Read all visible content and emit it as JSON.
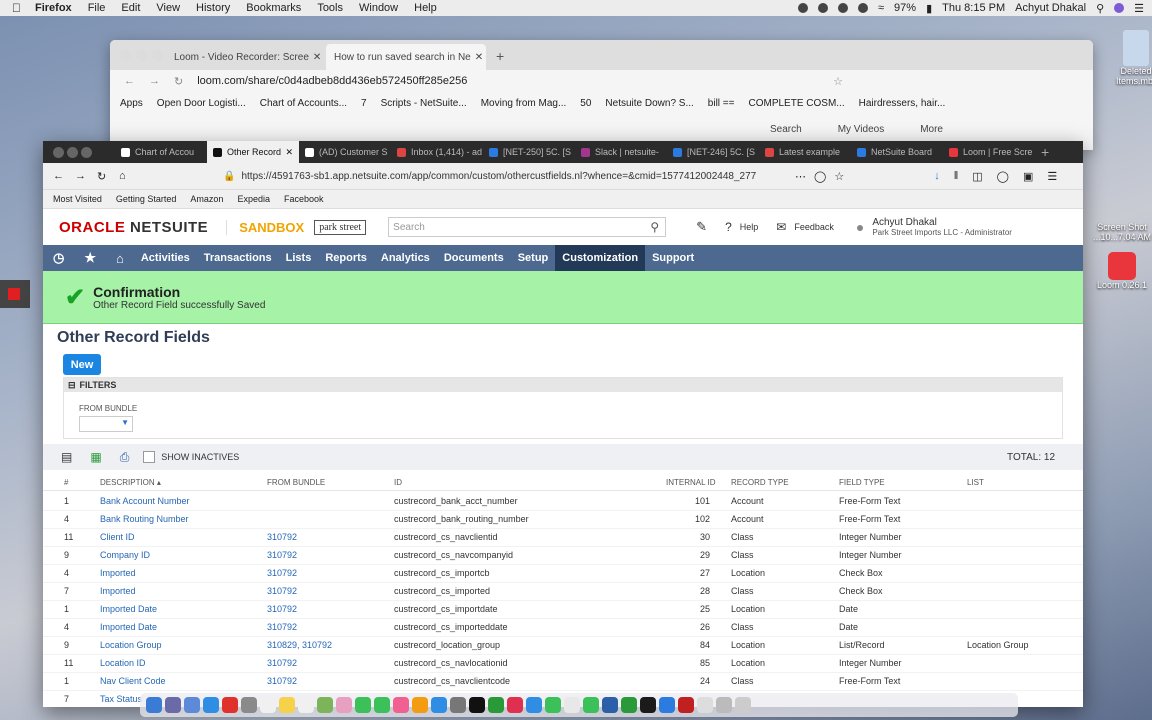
{
  "menubar": {
    "app": "Firefox",
    "items": [
      "File",
      "Edit",
      "View",
      "History",
      "Bookmarks",
      "Tools",
      "Window",
      "Help"
    ],
    "battery": "97%",
    "clock": "Thu 8:15 PM",
    "user": "Achyut Dhakal"
  },
  "desktop": {
    "deleted_label": "Deleted Items.mbox",
    "screenshot_label": "Screen Shot ...10...7.04 AM",
    "loom_label": "Loom 0.26.1"
  },
  "back_window": {
    "tabs": [
      "Loom - Video Recorder: Scree",
      "How to run saved search in Ne"
    ],
    "url": "loom.com/share/c0d4adbeb8dd436eb572450ff285e256",
    "bookmarks": [
      "Apps",
      "Open Door Logisti...",
      "Chart of Accounts...",
      "7",
      "Scripts - NetSuite...",
      "Moving from Mag...",
      "50",
      "Netsuite Down? S...",
      "bill ==",
      "COMPLETE COSM...",
      "Hairdressers, hair..."
    ],
    "page_links": [
      "Search",
      "My Videos",
      "More"
    ]
  },
  "front_window": {
    "tabs": [
      "Chart of Accou",
      "Other Record",
      "(AD) Customer S",
      "Inbox (1,414) - ad",
      "[NET-250] 5C. [S",
      "Slack | netsuite-",
      "[NET-246] 5C. [S",
      "Latest example",
      "NetSuite Board",
      "Loom | Free Scre"
    ],
    "url": "https://4591763-sb1.app.netsuite.com/app/common/custom/othercustfields.nl?whence=&cmid=1577412002448_277",
    "bookmarks": [
      "Most Visited",
      "Getting Started",
      "Amazon",
      "Expedia",
      "Facebook"
    ]
  },
  "netsuite": {
    "logo_oracle": "ORACLE",
    "logo_netsuite": "NETSUITE",
    "sandbox": "SANDBOX",
    "company_logo": "park street",
    "search_placeholder": "Search",
    "help": "Help",
    "feedback": "Feedback",
    "user_name": "Achyut Dhakal",
    "user_role": "Park Street Imports LLC - Administrator",
    "nav": [
      "Activities",
      "Transactions",
      "Lists",
      "Reports",
      "Analytics",
      "Documents",
      "Setup",
      "Customization",
      "Support"
    ],
    "nav_active": "Customization"
  },
  "confirmation": {
    "title": "Confirmation",
    "message": "Other Record Field successfully Saved"
  },
  "page": {
    "title": "Other Record Fields",
    "new_button": "New",
    "filters_label": "FILTERS",
    "from_bundle_label": "FROM BUNDLE",
    "show_inactives": "SHOW INACTIVES",
    "total": "TOTAL: 12"
  },
  "table": {
    "headers": {
      "num": "#",
      "desc": "DESCRIPTION ▴",
      "bundle": "FROM BUNDLE",
      "id": "ID",
      "internal": "INTERNAL ID",
      "record": "RECORD TYPE",
      "field": "FIELD TYPE",
      "list": "LIST"
    },
    "rows": [
      {
        "num": "1",
        "desc": "Bank Account Number",
        "bundle": "",
        "id": "custrecord_bank_acct_number",
        "internal": "101",
        "record": "Account",
        "field": "Free-Form Text",
        "list": ""
      },
      {
        "num": "4",
        "desc": "Bank Routing Number",
        "bundle": "",
        "id": "custrecord_bank_routing_number",
        "internal": "102",
        "record": "Account",
        "field": "Free-Form Text",
        "list": ""
      },
      {
        "num": "11",
        "desc": "Client ID",
        "bundle": "310792",
        "id": "custrecord_cs_navclientid",
        "internal": "30",
        "record": "Class",
        "field": "Integer Number",
        "list": ""
      },
      {
        "num": "9",
        "desc": "Company ID",
        "bundle": "310792",
        "id": "custrecord_cs_navcompanyid",
        "internal": "29",
        "record": "Class",
        "field": "Integer Number",
        "list": ""
      },
      {
        "num": "4",
        "desc": "Imported",
        "bundle": "310792",
        "id": "custrecord_cs_importcb",
        "internal": "27",
        "record": "Location",
        "field": "Check Box",
        "list": ""
      },
      {
        "num": "7",
        "desc": "Imported",
        "bundle": "310792",
        "id": "custrecord_cs_imported",
        "internal": "28",
        "record": "Class",
        "field": "Check Box",
        "list": ""
      },
      {
        "num": "1",
        "desc": "Imported Date",
        "bundle": "310792",
        "id": "custrecord_cs_importdate",
        "internal": "25",
        "record": "Location",
        "field": "Date",
        "list": ""
      },
      {
        "num": "4",
        "desc": "Imported Date",
        "bundle": "310792",
        "id": "custrecord_cs_importeddate",
        "internal": "26",
        "record": "Class",
        "field": "Date",
        "list": ""
      },
      {
        "num": "9",
        "desc": "Location Group",
        "bundle": "310829, 310792",
        "id": "custrecord_location_group",
        "internal": "84",
        "record": "Location",
        "field": "List/Record",
        "list": "Location Group"
      },
      {
        "num": "11",
        "desc": "Location ID",
        "bundle": "310792",
        "id": "custrecord_cs_navlocationid",
        "internal": "85",
        "record": "Location",
        "field": "Integer Number",
        "list": ""
      },
      {
        "num": "1",
        "desc": "Nav Client Code",
        "bundle": "310792",
        "id": "custrecord_cs_navclientcode",
        "internal": "24",
        "record": "Class",
        "field": "Free-Form Text",
        "list": ""
      },
      {
        "num": "7",
        "desc": "Tax Status",
        "bundle": "",
        "id": "",
        "internal": "",
        "record": "",
        "field": "",
        "list": ""
      }
    ]
  },
  "colors": {
    "nav_bg": "#4d6990",
    "nav_active": "#233958",
    "confirm_bg": "#a6f2a7",
    "link": "#2566b5",
    "new_button": "#1b85e2"
  }
}
